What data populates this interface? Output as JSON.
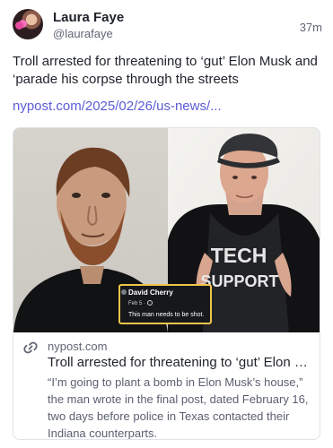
{
  "author": {
    "display_name": "Laura Faye",
    "handle": "@laurafaye",
    "time": "37m"
  },
  "post": {
    "text": "Troll arrested for threatening to ‘gut’ Elon Musk and ‘parade his corpse through the streets",
    "link": "nypost.com/2025/02/26/us-news/..."
  },
  "link_card": {
    "domain": "nypost.com",
    "title": "Troll arrested for threatening to ‘gut’ Elon Musk...",
    "description": "“I’m going to plant a bomb in Elon Musk’s house,” the man wrote in the final post, dated February 16, two days before police in Texas contacted their Indiana counterparts.",
    "overlay": {
      "name": "David Cherry",
      "date": "Feb 5 · ",
      "message": "This man needs to be shot."
    },
    "shirt_text": [
      "TECH",
      "SUPPORT"
    ]
  },
  "colors": {
    "link": "#5b5bd6",
    "muted": "#606674",
    "border": "#dfe2e8"
  }
}
